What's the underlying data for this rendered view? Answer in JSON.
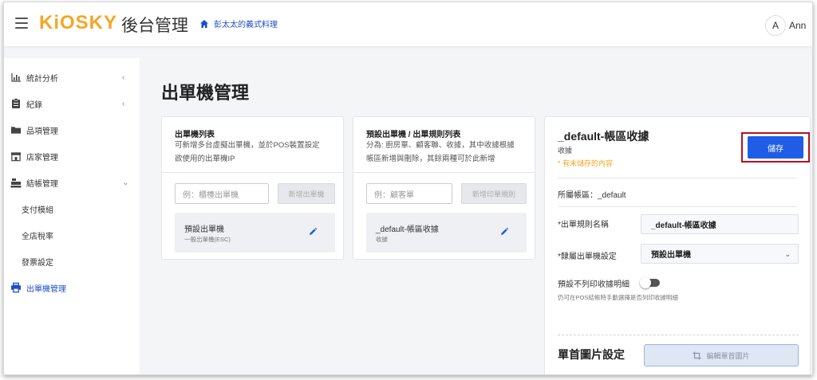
{
  "header": {
    "logo": "KiOSKY",
    "title": "後台管理",
    "store": "彭太太的義式料理",
    "avatar_initial": "A",
    "user_name": "Ann"
  },
  "sidebar": {
    "items": [
      {
        "label": "統計分析",
        "icon": "bar-chart-icon"
      },
      {
        "label": "紀錄",
        "icon": "clipboard-icon"
      },
      {
        "label": "品項管理",
        "icon": "folder-icon"
      },
      {
        "label": "店家管理",
        "icon": "store-icon"
      },
      {
        "label": "結帳管理",
        "icon": "cash-register-icon"
      },
      {
        "label": "支付模組"
      },
      {
        "label": "全店稅率"
      },
      {
        "label": "發票設定"
      },
      {
        "label": "出單機管理",
        "icon": "printer-icon"
      }
    ]
  },
  "page": {
    "title": "出單機管理"
  },
  "printers_panel": {
    "title": "出單機列表",
    "desc_line1": "可新增多台虛擬出單機，並於POS裝置設定",
    "desc_line2": "欲使用的出單機IP",
    "input_placeholder": "例：櫃檯出單機",
    "add_label": "新增出單機",
    "item_title": "預設出單機",
    "item_sub": "一般出單機(ESC)"
  },
  "rules_panel": {
    "title": "預設出單機 / 出單規則列表",
    "desc_line1": "分為: 廚房單、顧客聯、收據，其中收據根據",
    "desc_line2": "帳區新增與刪除，其餘兩種可於此新增",
    "input_placeholder": "例：顧客單",
    "add_label": "新增印單規則",
    "item_title": "_default-帳區收據",
    "item_sub": "收據"
  },
  "detail_panel": {
    "title": "_default-帳區收據",
    "subtitle": "收據",
    "unsaved": "* 有未儲存的內容",
    "save_label": "儲存",
    "account_area": "所屬帳區：_default",
    "rule_name_label": "*出單規則名稱",
    "rule_name_value": "_default-帳區收據",
    "printer_label": "*隸屬出單機設定",
    "printer_value": "預設出單機",
    "no_detail_label": "預設不列印收據明細",
    "no_detail_hint": "仍可在POS結帳時手動選擇是否列印收據明細",
    "header_img_section": "單首圖片設定",
    "edit_img_label": "編輯單首圖片"
  },
  "colors": {
    "brand": "#f5a623",
    "primary": "#1f5de6",
    "link": "#1f4fc9",
    "highlight": "#b3121c"
  }
}
